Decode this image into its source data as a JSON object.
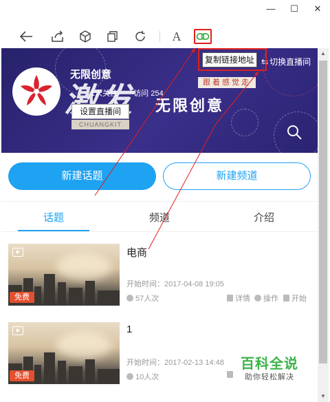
{
  "window": {
    "minimize_symbol": "—",
    "maximize_symbol": "☐",
    "close_symbol": "✕"
  },
  "toolbar": {
    "font_label": "A",
    "icons": [
      "back-arrow-icon",
      "share-icon",
      "cube-icon",
      "copy-pages-icon",
      "refresh-icon",
      "font-icon",
      "link-icon"
    ],
    "highlight_color": "#e0201c"
  },
  "tooltip": {
    "text": "复制链接地址"
  },
  "channel": {
    "name": "无限创意",
    "follow": "1人关注",
    "visits": "访问 254",
    "setup_button": "设置直播间",
    "brand_en": "CHUANGKIT",
    "switch_live": "切换直播间",
    "banner_word": "激发",
    "banner_sub": "无限创意",
    "tagline": "跟着感觉走"
  },
  "actions": {
    "new_topic": "新建话题",
    "new_channel": "新建频道"
  },
  "tabs": [
    {
      "label": "话题",
      "active": true
    },
    {
      "label": "频道",
      "active": false
    },
    {
      "label": "介绍",
      "active": false
    }
  ],
  "topics": [
    {
      "title": "电商",
      "badge": "免费",
      "time": "开始时间：2017-04-08 19:05",
      "views": "57人次",
      "actions": [
        "详情",
        "操作",
        "开始"
      ]
    },
    {
      "title": "1",
      "badge": "免费",
      "time": "开始时间：2017-02-13 14:48",
      "views": "10人次",
      "actions": []
    }
  ],
  "watermark": {
    "title": "百科全说",
    "sub": "助你轻松解决"
  },
  "colors": {
    "accent": "#1ea2f2",
    "banner": "#2c2678",
    "badge": "#e3502f",
    "annotation": "#e0201c"
  }
}
